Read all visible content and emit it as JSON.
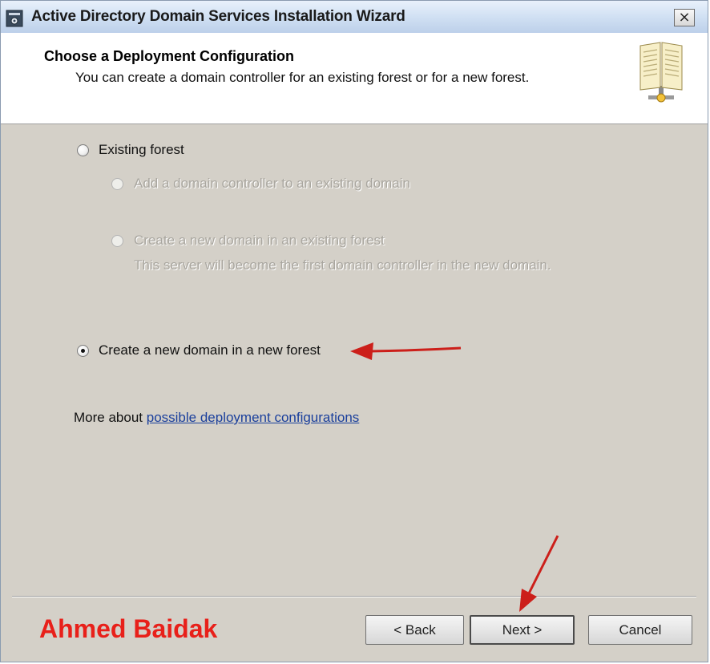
{
  "window": {
    "title": "Active Directory Domain Services Installation Wizard",
    "close_glyph": "×"
  },
  "header": {
    "title": "Choose a Deployment Configuration",
    "subtitle": "You can create a domain controller for an existing forest or for a new forest."
  },
  "options": {
    "existing_forest": "Existing forest",
    "add_dc": "Add a domain controller to an existing domain",
    "new_domain_existing_forest": "Create a new domain in an existing forest",
    "new_domain_existing_forest_desc": "This server will become the first domain controller in the new domain.",
    "new_forest": "Create a new domain in a new forest",
    "selected": "new_forest"
  },
  "more_about": {
    "prefix": "More about ",
    "link_text": "possible deployment configurations"
  },
  "watermark": "Ahmed Baidak",
  "buttons": {
    "back": "< Back",
    "next": "Next >",
    "cancel": "Cancel"
  },
  "colors": {
    "dialog_bg": "#d4d0c8",
    "annotation_arrow": "#cc1f1a",
    "watermark": "#e8201a",
    "link": "#1a3f9c"
  },
  "icons": [
    "app-icon",
    "close-icon",
    "book-icon"
  ]
}
